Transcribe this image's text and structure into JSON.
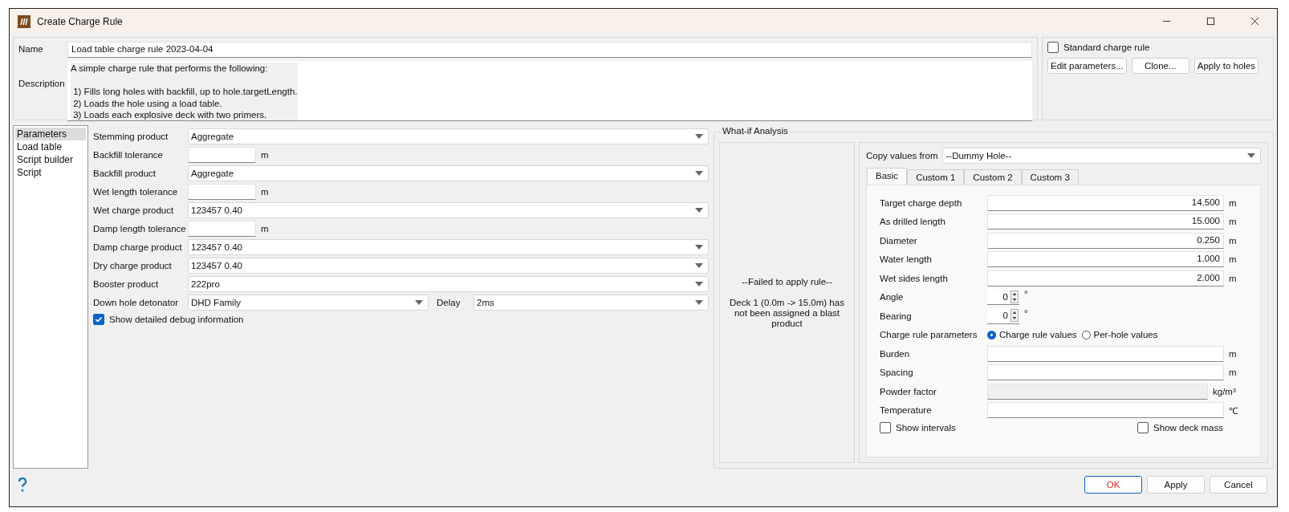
{
  "window": {
    "title": "Create Charge Rule"
  },
  "name": {
    "label": "Name",
    "value": "Load table charge rule 2023-04-04"
  },
  "description": {
    "label": "Description",
    "value": "A simple charge rule that performs the following:\n\n 1) Fills long holes with backfill, up to hole.targetLength.\n 2) Loads the hole using a load table.\n 3) Loads each explosive deck with two primers."
  },
  "standard_charge_rule": {
    "label": "Standard charge rule",
    "checked": false
  },
  "top_buttons": [
    "Edit parameters...",
    "Clone...",
    "Apply to holes"
  ],
  "sidebar": {
    "items": [
      {
        "label": "Parameters",
        "selected": true
      },
      {
        "label": "Load table",
        "selected": false
      },
      {
        "label": "Script builder",
        "selected": false
      },
      {
        "label": "Script",
        "selected": false
      }
    ]
  },
  "parameters": {
    "rows": [
      {
        "kind": "combo",
        "label": "Stemming product",
        "value": "Aggregate"
      },
      {
        "kind": "number",
        "label": "Backfill tolerance",
        "unit": "m"
      },
      {
        "kind": "combo",
        "label": "Backfill product",
        "value": "Aggregate"
      },
      {
        "kind": "number",
        "label": "Wet length tolerance",
        "unit": "m"
      },
      {
        "kind": "combo",
        "label": "Wet charge product",
        "value": "123457 0.40"
      },
      {
        "kind": "number",
        "label": "Damp length tolerance",
        "unit": "m"
      },
      {
        "kind": "combo",
        "label": "Damp charge product",
        "value": "123457 0.40"
      },
      {
        "kind": "combo",
        "label": "Dry charge product",
        "value": "123457 0.40"
      },
      {
        "kind": "combo",
        "label": "Booster product",
        "value": "222pro"
      },
      {
        "kind": "detonator",
        "label": "Down hole detonator",
        "value": "DHD Family",
        "delay_label": "Delay",
        "delay_value": "2ms"
      }
    ],
    "debug": {
      "label": "Show detailed debug information",
      "checked": true
    }
  },
  "what_if": {
    "title": "What-if Analysis",
    "result": {
      "heading": "--Failed to apply rule--",
      "message": "Deck 1 (0.0m -> 15.0m) has not been assigned a blast product"
    },
    "copy_from": {
      "label": "Copy values from",
      "value": "--Dummy Hole--"
    },
    "tabs": [
      {
        "label": "Basic",
        "selected": true
      },
      {
        "label": "Custom 1",
        "selected": false
      },
      {
        "label": "Custom 2",
        "selected": false
      },
      {
        "label": "Custom 3",
        "selected": false
      }
    ],
    "fields": [
      {
        "kind": "text",
        "label": "Target charge depth",
        "value": "14.500",
        "unit": "m",
        "disabled": false
      },
      {
        "kind": "text",
        "label": "As drilled length",
        "value": "15.000",
        "unit": "m",
        "disabled": false
      },
      {
        "kind": "text",
        "label": "Diameter",
        "value": "0.250",
        "unit": "m",
        "disabled": false
      },
      {
        "kind": "text",
        "label": "Water length",
        "value": "1.000",
        "unit": "m",
        "disabled": false
      },
      {
        "kind": "text",
        "label": "Wet sides length",
        "value": "2.000",
        "unit": "m",
        "disabled": false
      },
      {
        "kind": "spin",
        "label": "Angle",
        "value": "0",
        "unit": "°"
      },
      {
        "kind": "spin",
        "label": "Bearing",
        "value": "0",
        "unit": "°"
      },
      {
        "kind": "radio",
        "label": "Charge rule parameters",
        "options": [
          {
            "label": "Charge rule values",
            "selected": true
          },
          {
            "label": "Per-hole values",
            "selected": false
          }
        ]
      },
      {
        "kind": "text",
        "label": "Burden",
        "unit": "m",
        "disabled": false
      },
      {
        "kind": "text",
        "label": "Spacing",
        "unit": "m",
        "disabled": false
      },
      {
        "kind": "text",
        "label": "Powder factor",
        "unit": "kg/m³",
        "disabled": true
      },
      {
        "kind": "text",
        "label": "Temperature",
        "unit": "℃",
        "disabled": false
      }
    ],
    "show_intervals": {
      "label": "Show intervals",
      "checked": false
    },
    "show_deck_mass": {
      "label": "Show deck mass",
      "checked": false
    }
  },
  "buttons": [
    {
      "label": "OK",
      "kind": "primary"
    },
    {
      "label": "Apply",
      "kind": "normal"
    },
    {
      "label": "Cancel",
      "kind": "normal"
    }
  ]
}
